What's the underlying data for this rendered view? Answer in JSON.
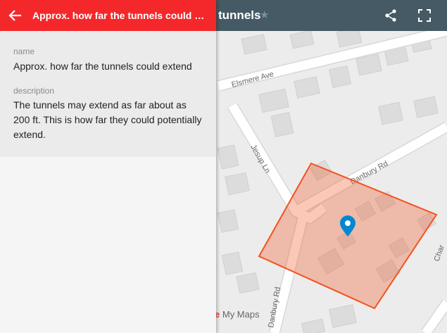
{
  "map": {
    "title": "tunnels",
    "streets": [
      "Elsmere Ave",
      "Jesup Ln",
      "Danbury Rd",
      "Danbury Rd",
      "Char"
    ],
    "attribution_prefix": "e",
    "attribution": "My Maps",
    "polygon_color": "#f4511e"
  },
  "toolbar": {
    "share_icon": "share-icon",
    "fullscreen_icon": "fullscreen-icon"
  },
  "panel": {
    "title": "Approx. how far the tunnels could extend",
    "name_label": "name",
    "name_value": "Approx. how far the tunnels could extend",
    "description_label": "description",
    "description_value": "The tunnels may extend as far about as 200 ft. This is how far they could potentially extend."
  },
  "colors": {
    "panel_header": "#f4282b",
    "toolbar": "#455a64",
    "marker": "#0288d1"
  }
}
